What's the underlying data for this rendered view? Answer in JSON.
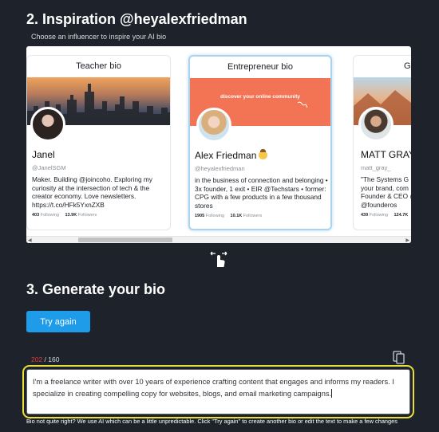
{
  "section2": {
    "title": "2. Inspiration @heyalexfriedman",
    "subtitle": "Choose an influencer to inspire your AI bio"
  },
  "cards": [
    {
      "header": "Teacher bio",
      "name": "Janel",
      "handle": "@JanelSGM",
      "bio": "Maker. Building @joincoho. Exploring my curiosity at the intersection of tech & the creator economy. Love newsletters. https://t.co/HFk5YxnZXB",
      "following_count": "403",
      "following_label": "Following",
      "followers_count": "13.9K",
      "followers_label": "Followers"
    },
    {
      "header": "Entrepreneur bio",
      "banner_text": "discover your online community",
      "name": "Alex Friedman",
      "handle": "@heyalexfriedman",
      "bio": "in the business of connection and belonging • 3x founder, 1 exit • EIR @Techstars • former: CPG with a few products in a few thousand stores",
      "following_count": "1905",
      "following_label": "Following",
      "followers_count": "10.1K",
      "followers_label": "Followers"
    },
    {
      "header": "G",
      "name": "MATT GRAY",
      "handle": "matt_gray_",
      "bio_lines": [
        "\"The Systems G",
        "your brand, com",
        "Founder & CEO @",
        "@founderos"
      ],
      "following_count": "439",
      "following_label": "Following",
      "followers_count": "124.7K",
      "followers_label": ""
    }
  ],
  "scrollbar": {
    "left_arrow": "◀",
    "right_arrow": "▶"
  },
  "icons": {
    "swipe": "swipe-hand-icon",
    "copy": "copy-icon",
    "emoji": "cowboy-emoji-icon"
  },
  "section3": {
    "title": "3. Generate your bio",
    "try_again_label": "Try again",
    "char_count": "202",
    "char_separator": " / ",
    "char_limit": "160",
    "bio_text": "I'm a freelance writer with over 10 years of experience crafting content that engages and informs my readers. I specialize in creating compelling copy for websites, blogs, and email marketing campaigns.",
    "hint": "Bio not quite right? We use AI which can be a little unpredictable. Click \"Try again\" to create another bio or edit the text to make a few changes"
  },
  "colors": {
    "background": "#1e232b",
    "accent_blue": "#1e9be9",
    "highlight_yellow": "#e8df3a",
    "over_limit_red": "#e03a3a",
    "banner_orange": "#f27455"
  }
}
